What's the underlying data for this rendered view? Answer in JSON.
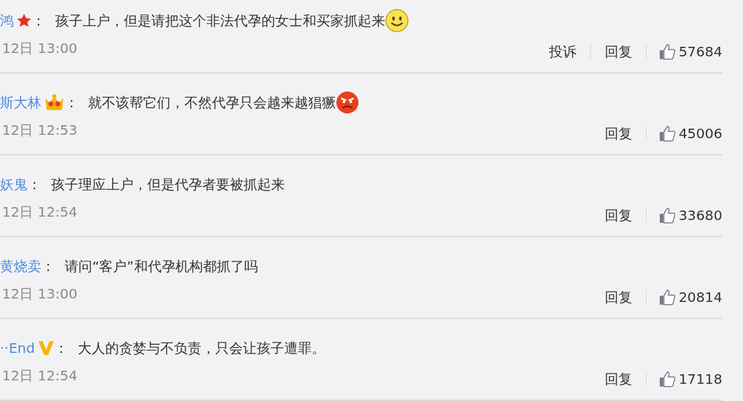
{
  "comments": [
    {
      "user": "鸿",
      "badge": {
        "kind": "star"
      },
      "sep": "：",
      "text": "孩子上户，但是请把这个非法代孕的女士和买家抓起来",
      "emoji": {
        "kind": "smile"
      },
      "time": "12日 13:00",
      "actions": [
        "投诉",
        "回复"
      ],
      "likes": "57684"
    },
    {
      "user": "斯大林",
      "badge": {
        "kind": "crown"
      },
      "sep": "：",
      "text": "就不该帮它们，不然代孕只会越来越猖獗",
      "emoji": {
        "kind": "angry"
      },
      "time": "12日 12:53",
      "actions": [
        "回复"
      ],
      "likes": "45006"
    },
    {
      "user": "妖鬼",
      "sep": "：",
      "text": "孩子理应上户，但是代孕者要被抓起来",
      "time": "12日 12:54",
      "actions": [
        "回复"
      ],
      "likes": "33680"
    },
    {
      "user": "黄烧卖",
      "sep": "：",
      "text": "请问“客户”和代孕机构都抓了吗",
      "time": "12日 13:00",
      "actions": [
        "回复"
      ],
      "likes": "20814"
    },
    {
      "user": "··End",
      "badge": {
        "kind": "v"
      },
      "sep": "：",
      "text": "大人的贪婪与不负责，只会让孩子遭罪。",
      "time": "12日 12:54",
      "actions": [
        "回复"
      ],
      "likes": "17118"
    }
  ]
}
